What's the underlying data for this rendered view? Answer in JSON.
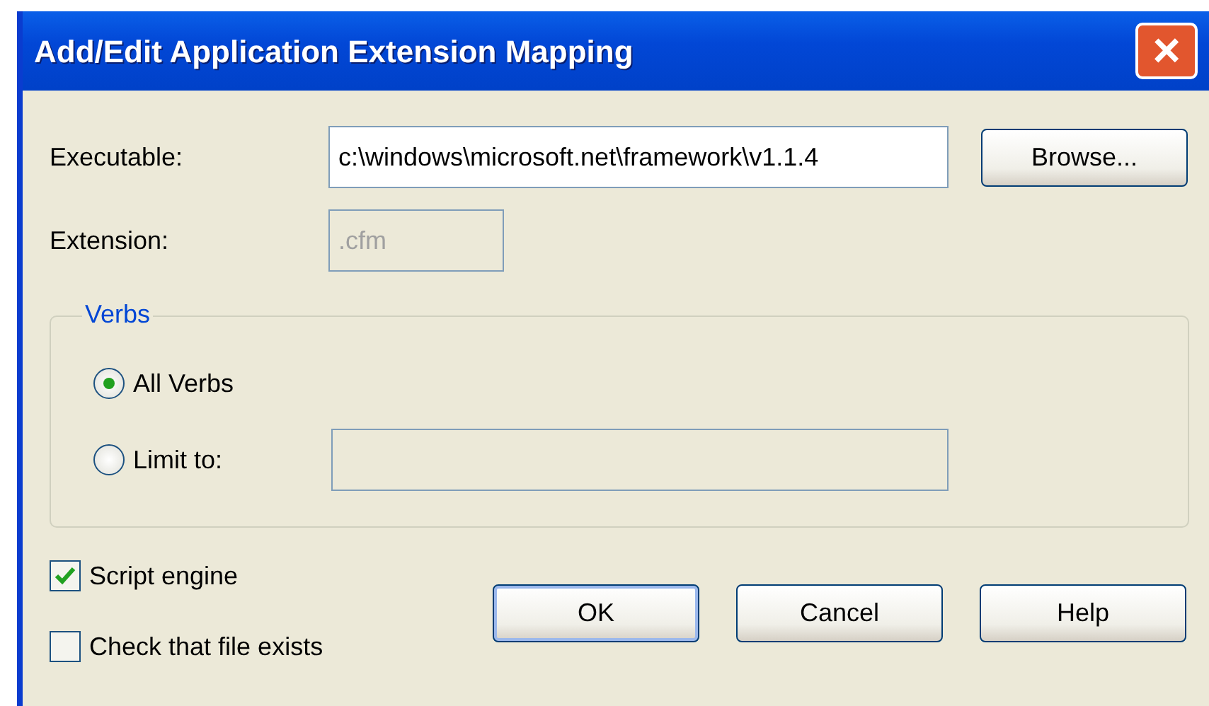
{
  "window": {
    "title": "Add/Edit Application Extension Mapping",
    "close": "×"
  },
  "executable": {
    "label": "Executable:",
    "value": "c:\\windows\\microsoft.net\\framework\\v1.1.4",
    "disabled": false
  },
  "browse_button": "Browse...",
  "extension": {
    "label": "Extension:",
    "value": ".cfm",
    "disabled": true
  },
  "verbs": {
    "title": "Verbs",
    "options": [
      {
        "label": "All Verbs",
        "selected": true
      },
      {
        "label": "Limit to:",
        "selected": false,
        "field": {
          "disabled": true
        }
      }
    ]
  },
  "checkboxes": [
    {
      "label": "Script engine",
      "checked": true
    },
    {
      "label": "Check that file exists",
      "checked": false
    }
  ],
  "buttons": [
    {
      "label": "OK",
      "default": true
    },
    {
      "label": "Cancel",
      "default": false
    },
    {
      "label": "Help",
      "default": false
    }
  ]
}
